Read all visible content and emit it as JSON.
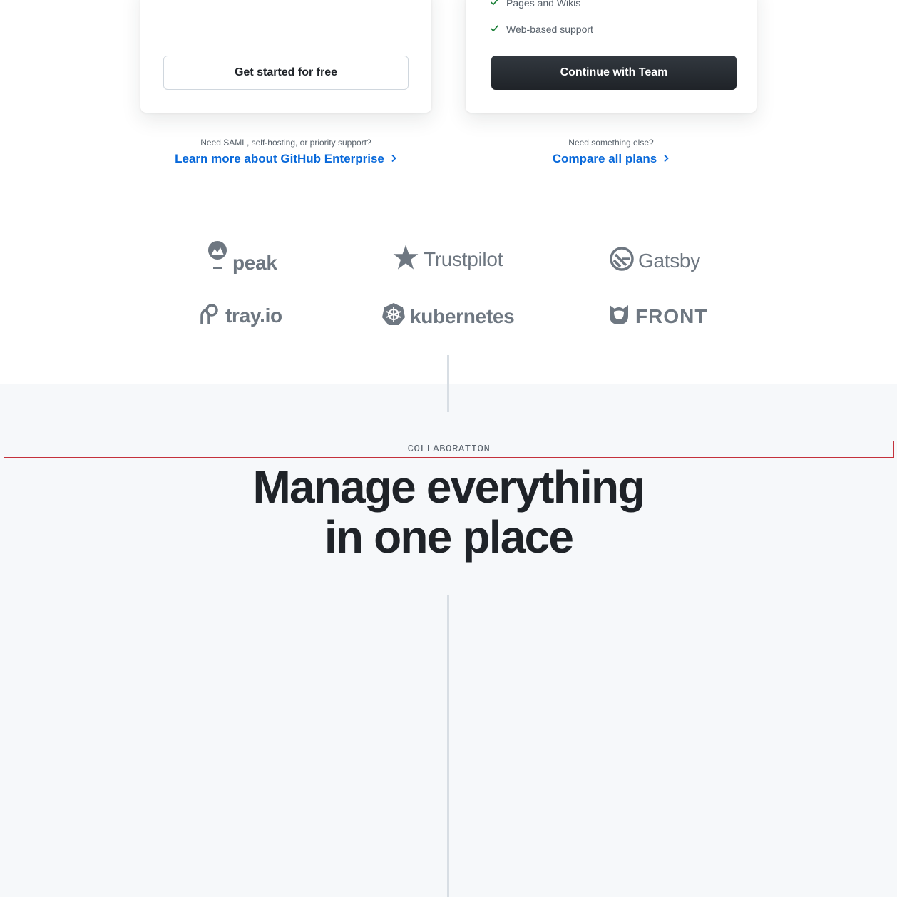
{
  "pricing": {
    "free": {
      "button_label": "Get started for free",
      "below_note": "Need SAML, self-hosting, or priority support?",
      "below_link": "Learn more about GitHub Enterprise"
    },
    "team": {
      "features": [
        "Pages and Wikis",
        "Web-based support"
      ],
      "button_label": "Continue with Team",
      "below_note": "Need something else?",
      "below_link": "Compare all plans"
    }
  },
  "logos": {
    "peak": "peak",
    "trustpilot": "Trustpilot",
    "gatsby": "Gatsby",
    "tray": "tray.io",
    "kubernetes": "kubernetes",
    "front": "FRONT"
  },
  "collaboration": {
    "eyebrow": "COLLABORATION",
    "headline_line1": "Manage everything",
    "headline_line2": "in one place"
  },
  "colors": {
    "link": "#0969da",
    "check": "#1a7f37",
    "dark_button": "#24292f",
    "section_bg": "#f6f8fa"
  }
}
